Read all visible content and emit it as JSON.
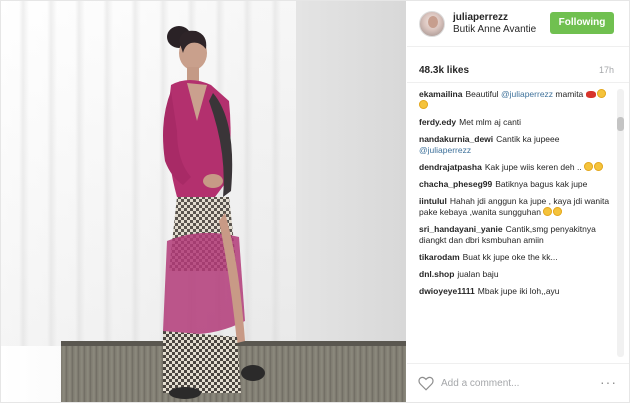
{
  "post": {
    "username": "juliaperrezz",
    "location": "Butik Anne Avantie",
    "follow_button": "Following",
    "likes": "48.3k likes",
    "time": "17h",
    "add_comment_placeholder": "Add a comment...",
    "more_label": "···"
  },
  "comments": [
    {
      "user": "ekamailina",
      "text": "Beautiful",
      "mention": "@juliaperrezz",
      "text2": "mamita",
      "emojis": [
        "lips",
        "heart-eyes",
        "smile"
      ]
    },
    {
      "user": "ferdy.edy",
      "text": "Met mlm aj canti"
    },
    {
      "user": "nandakurnia_dewi",
      "text": "Cantik ka jupeee",
      "mention": "@juliaperrezz"
    },
    {
      "user": "dendrajatpasha",
      "text": "Kak jupe wiis keren deh ..",
      "emojis": [
        "sad",
        "heart-eyes"
      ]
    },
    {
      "user": "chacha_pheseg99",
      "text": "Batiknya bagus kak jupe"
    },
    {
      "user": "iintulul",
      "text": "Hahah jdi anggun ka jupe , kaya jdi wanita pake kebaya ,wanita sungguhan",
      "emojis": [
        "smile",
        "smile"
      ]
    },
    {
      "user": "sri_handayani_yanie",
      "text": "Cantik,smg penyakitnya diangkt dan dbri ksmbuhan amiin"
    },
    {
      "user": "tikarodam",
      "text": "Buat kk jupe oke the kk..."
    },
    {
      "user": "dnl.shop",
      "text": "jualan baju"
    },
    {
      "user": "dwioyeye1111",
      "text": "Mbak jupe iki loh,,ayu"
    }
  ],
  "colors": {
    "follow_bg": "#70c050",
    "mention": "#3f729b",
    "muted": "#a5a7aa",
    "kebaya": "#b3306e"
  },
  "icons": {
    "heart": "heart-icon",
    "more": "more-options-icon"
  }
}
